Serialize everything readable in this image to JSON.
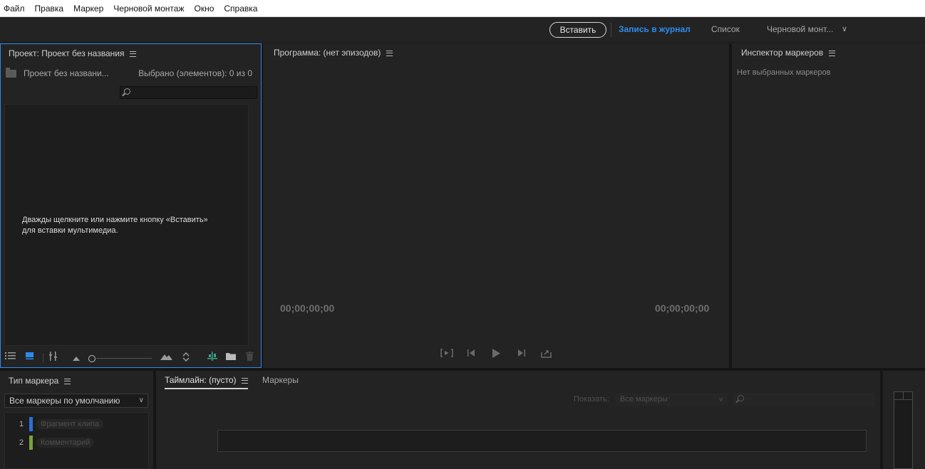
{
  "menu": [
    "Файл",
    "Правка",
    "Маркер",
    "Черновой монтаж",
    "Окно",
    "Справка"
  ],
  "workspace": {
    "import_button": "Вставить",
    "tabs": [
      {
        "label": "Запись в журнал",
        "active": true
      },
      {
        "label": "Список",
        "active": false
      },
      {
        "label": "Черновой монт...",
        "active": false
      }
    ]
  },
  "project": {
    "title": "Проект: Проект без названия",
    "name": "Проект без названи...",
    "selected": "Выбрано (элементов): 0 из 0",
    "search_placeholder": "",
    "empty_line1": "Дважды щелкните или нажмите кнопку «Вставить»",
    "empty_line2": "для вставки мультимедиа."
  },
  "program": {
    "title": "Программа: (нет эпизодов)",
    "tc_in": "00;00;00;00",
    "tc_out": "00;00;00;00"
  },
  "inspector": {
    "title": "Инспектор маркеров",
    "empty": "Нет выбранных маркеров"
  },
  "marker_type": {
    "title": "Тип маркера",
    "dropdown": "Все маркеры по умолчанию",
    "items": [
      {
        "num": "1",
        "label": "Фрагмент клипа",
        "color": "#2a6fd6"
      },
      {
        "num": "2",
        "label": "Комментарий",
        "color": "#7aa13a"
      }
    ]
  },
  "timeline": {
    "tab_active": "Таймлайн: (пусто)",
    "tab_markers": "Маркеры",
    "show_label": "Показать:",
    "show_value": "Все маркеры"
  },
  "colors": {
    "accent": "#2d8ceb",
    "bg": "#232323"
  }
}
